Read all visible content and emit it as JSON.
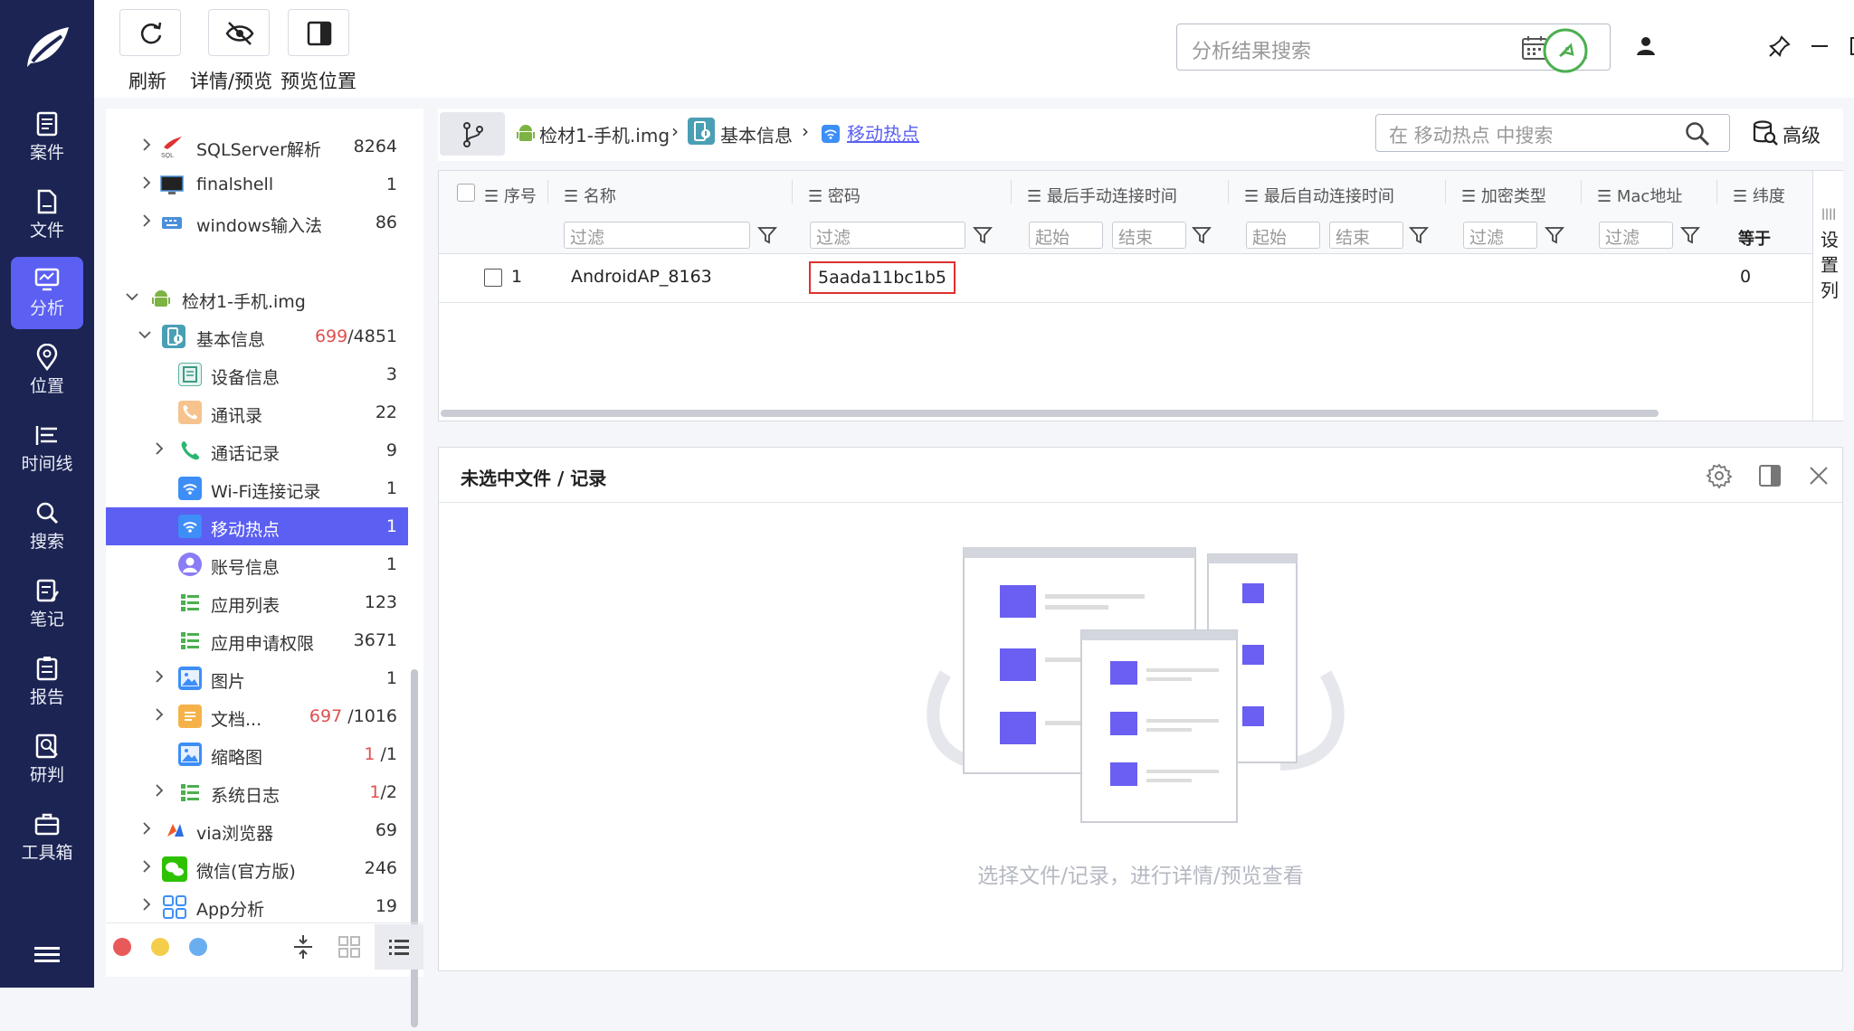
{
  "toolbar": {
    "refresh": "刷新",
    "detail_preview": "详情/预览",
    "preview_position": "预览位置",
    "search_placeholder": "分析结果搜索"
  },
  "nav": [
    {
      "label": "案件",
      "icon": "case-icon"
    },
    {
      "label": "文件",
      "icon": "file-icon"
    },
    {
      "label": "分析",
      "icon": "analysis-icon",
      "active": true
    },
    {
      "label": "位置",
      "icon": "location-icon"
    },
    {
      "label": "时间线",
      "icon": "timeline-icon"
    },
    {
      "label": "搜索",
      "icon": "search-icon"
    },
    {
      "label": "笔记",
      "icon": "note-icon"
    },
    {
      "label": "报告",
      "icon": "report-icon"
    },
    {
      "label": "研判",
      "icon": "judge-icon"
    },
    {
      "label": "工具箱",
      "icon": "toolbox-icon"
    }
  ],
  "tree": {
    "sqlserver": {
      "label": "SQLServer解析",
      "count": "8264"
    },
    "finalshell": {
      "label": "finalshell",
      "count": "1"
    },
    "windows_ime": {
      "label": "windows输入法",
      "count": "86"
    },
    "evidence": {
      "label": "检材1-手机.img"
    },
    "basic": {
      "label": "基本信息",
      "count_red": "699",
      "count_total": "/4851"
    },
    "device": {
      "label": "设备信息",
      "count": "3"
    },
    "contacts": {
      "label": "通讯录",
      "count": "22"
    },
    "calls": {
      "label": "通话记录",
      "count": "9"
    },
    "wifi": {
      "label": "Wi-Fi连接记录",
      "count": "1"
    },
    "hotspot": {
      "label": "移动热点",
      "count": "1"
    },
    "account": {
      "label": "账号信息",
      "count": "1"
    },
    "apps": {
      "label": "应用列表",
      "count": "123"
    },
    "perms": {
      "label": "应用申请权限",
      "count": "3671"
    },
    "pictures": {
      "label": "图片",
      "count": "1"
    },
    "docs": {
      "label": "文档...",
      "count_red": "697",
      "count_total": "/1016"
    },
    "thumbs": {
      "label": "缩略图",
      "count_red": "1",
      "count_total": "/1"
    },
    "syslog": {
      "label": "系统日志",
      "count_red": "1",
      "count_total": "/2"
    },
    "via": {
      "label": "via浏览器",
      "count": "69"
    },
    "wechat": {
      "label": "微信(官方版)",
      "count": "246"
    },
    "appanalysis": {
      "label": "App分析",
      "count": "19"
    }
  },
  "crumb": {
    "evidence": "检材1-手机.img",
    "basic": "基本信息",
    "current": "移动热点",
    "search_placeholder": "在 移动热点 中搜索",
    "advanced": "高级"
  },
  "table": {
    "headers": {
      "index": "序号",
      "name": "名称",
      "password": "密码",
      "last_manual": "最后手动连接时间",
      "last_auto": "最后自动连接时间",
      "encryption": "加密类型",
      "mac": "Mac地址",
      "latitude": "纬度"
    },
    "filter": "过滤",
    "start": "起始",
    "end": "结束",
    "equals": "等于",
    "settings_col": "设置列",
    "rows": [
      {
        "index": "1",
        "name": "AndroidAP_8163",
        "password": "5aada11bc1b5",
        "latitude": "0"
      }
    ]
  },
  "preview": {
    "title": "未选中文件 / 记录",
    "empty_hint": "选择文件/记录，进行详情/预览查看"
  },
  "colors": {
    "nav_bg": "#1b2452",
    "accent": "#5b5ff2",
    "highlight": "#e03030"
  }
}
